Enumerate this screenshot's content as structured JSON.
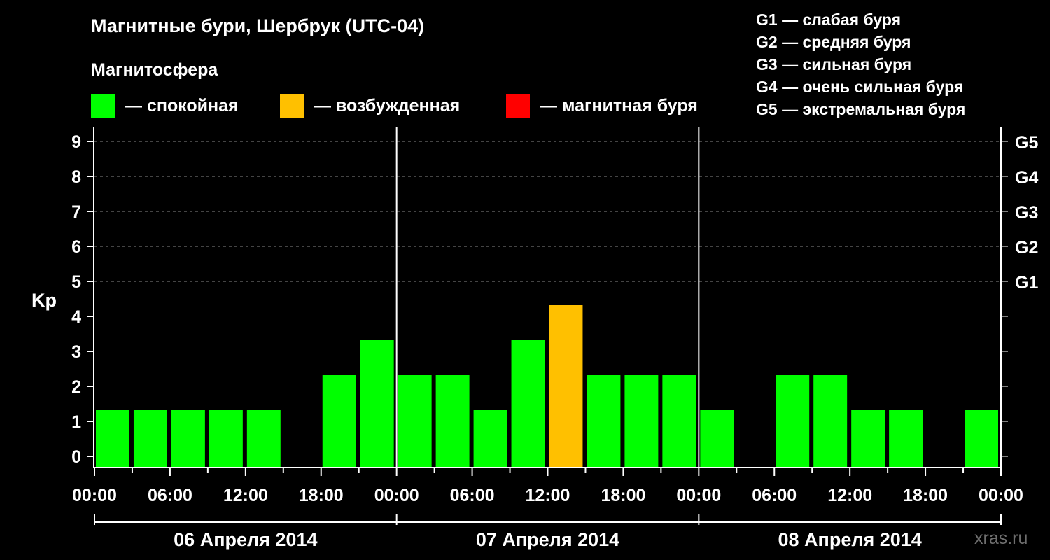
{
  "header": {
    "title": "Магнитные бури, Шербрук (UTC-04)",
    "magnetosphere_label": "Магнитосфера"
  },
  "legend": [
    {
      "color": "#00ff00",
      "label": "— спокойная"
    },
    {
      "color": "#ffc000",
      "label": "— возбужденная"
    },
    {
      "color": "#ff0000",
      "label": "— магнитная буря"
    }
  ],
  "storm_scale": [
    "G1 — слабая буря",
    "G2 — средняя буря",
    "G3 — сильная буря",
    "G4 — очень сильная буря",
    "G5 — экстремальная буря"
  ],
  "watermark": "xras.ru",
  "chart_data": {
    "type": "bar",
    "ylabel": "Kp",
    "ylim": [
      0,
      9
    ],
    "y_ticks": [
      "0",
      "1",
      "2",
      "3",
      "4",
      "5",
      "6",
      "7",
      "8",
      "9"
    ],
    "right_ticks": [
      {
        "kp": 5,
        "label": "G1"
      },
      {
        "kp": 6,
        "label": "G2"
      },
      {
        "kp": 7,
        "label": "G3"
      },
      {
        "kp": 8,
        "label": "G4"
      },
      {
        "kp": 9,
        "label": "G5"
      }
    ],
    "x_hours_range": [
      0,
      72
    ],
    "x_tick_labels": [
      "00:00",
      "06:00",
      "12:00",
      "18:00",
      "00:00",
      "06:00",
      "12:00",
      "18:00",
      "00:00",
      "06:00",
      "12:00",
      "18:00",
      "00:00"
    ],
    "days": [
      "06 Апреля 2014",
      "07 Апреля 2014",
      "08 Апреля 2014"
    ],
    "bars": [
      {
        "start_h": 0,
        "end_h": 3,
        "kp": 1,
        "level": "quiet"
      },
      {
        "start_h": 3,
        "end_h": 6,
        "kp": 1,
        "level": "quiet"
      },
      {
        "start_h": 6,
        "end_h": 9,
        "kp": 1,
        "level": "quiet"
      },
      {
        "start_h": 9,
        "end_h": 12,
        "kp": 1,
        "level": "quiet"
      },
      {
        "start_h": 12,
        "end_h": 15,
        "kp": 1,
        "level": "quiet"
      },
      {
        "start_h": 15,
        "end_h": 18,
        "kp": 0,
        "level": "quiet"
      },
      {
        "start_h": 18,
        "end_h": 21,
        "kp": 2,
        "level": "quiet"
      },
      {
        "start_h": 21,
        "end_h": 24,
        "kp": 3,
        "level": "quiet"
      },
      {
        "start_h": 24,
        "end_h": 27,
        "kp": 2,
        "level": "quiet"
      },
      {
        "start_h": 27,
        "end_h": 30,
        "kp": 2,
        "level": "quiet"
      },
      {
        "start_h": 30,
        "end_h": 33,
        "kp": 1,
        "level": "quiet"
      },
      {
        "start_h": 33,
        "end_h": 36,
        "kp": 3,
        "level": "quiet"
      },
      {
        "start_h": 36,
        "end_h": 39,
        "kp": 4,
        "level": "active"
      },
      {
        "start_h": 39,
        "end_h": 42,
        "kp": 2,
        "level": "quiet"
      },
      {
        "start_h": 42,
        "end_h": 45,
        "kp": 2,
        "level": "quiet"
      },
      {
        "start_h": 45,
        "end_h": 48,
        "kp": 2,
        "level": "quiet"
      },
      {
        "start_h": 48,
        "end_h": 51,
        "kp": 1,
        "level": "quiet"
      },
      {
        "start_h": 51,
        "end_h": 54,
        "kp": 0,
        "level": "quiet"
      },
      {
        "start_h": 54,
        "end_h": 57,
        "kp": 2,
        "level": "quiet"
      },
      {
        "start_h": 57,
        "end_h": 60,
        "kp": 2,
        "level": "quiet"
      },
      {
        "start_h": 60,
        "end_h": 63,
        "kp": 1,
        "level": "quiet"
      },
      {
        "start_h": 63,
        "end_h": 66,
        "kp": 1,
        "level": "quiet"
      },
      {
        "start_h": 66,
        "end_h": 69,
        "kp": 0,
        "level": "quiet"
      },
      {
        "start_h": 69,
        "end_h": 72,
        "kp": 1,
        "level": "quiet"
      }
    ],
    "level_colors": {
      "quiet": "#00ff00",
      "active": "#ffc000",
      "storm": "#ff0000"
    },
    "grid": true,
    "legend_placement": "top"
  }
}
